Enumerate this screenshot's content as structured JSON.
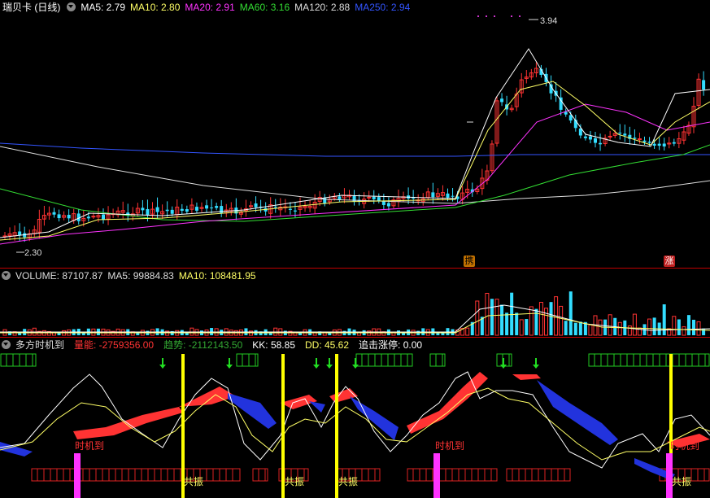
{
  "main": {
    "title": "瑞贝卡 (日线)",
    "ma": [
      {
        "label": "MA5: 2.79",
        "color": "#ffffff"
      },
      {
        "label": "MA10: 2.80",
        "color": "#ffff66"
      },
      {
        "label": "MA20: 2.91",
        "color": "#ff33ff"
      },
      {
        "label": "MA60: 3.16",
        "color": "#33dd33"
      },
      {
        "label": "MA120: 2.88",
        "color": "#dddddd"
      },
      {
        "label": "MA250: 2.94",
        "color": "#3355ff"
      }
    ],
    "high_label": "3.94",
    "low_label": "2.30",
    "tags": [
      "携",
      "涨"
    ]
  },
  "volume": {
    "title": "VOLUME: 87107.87",
    "ma5": "MA5: 99884.83",
    "ma10": "MA10: 108481.95"
  },
  "indicator": {
    "title": "多方时机到",
    "items": [
      {
        "label": "量能: -2759356.00",
        "color": "#ff3333"
      },
      {
        "label": "趋势: -2112143.50",
        "color": "#33aa33"
      },
      {
        "label": "KK: 58.85",
        "color": "#ffffff"
      },
      {
        "label": "DD: 45.62",
        "color": "#ffff66"
      },
      {
        "label": "追击涨停: 0.00",
        "color": "#ffffff"
      }
    ],
    "signal_text": "时机到",
    "resonance_text": "共振"
  },
  "colors": {
    "up": "#ff3333",
    "down": "#33ddff",
    "grid": "#c00000",
    "bg": "#000000"
  }
}
